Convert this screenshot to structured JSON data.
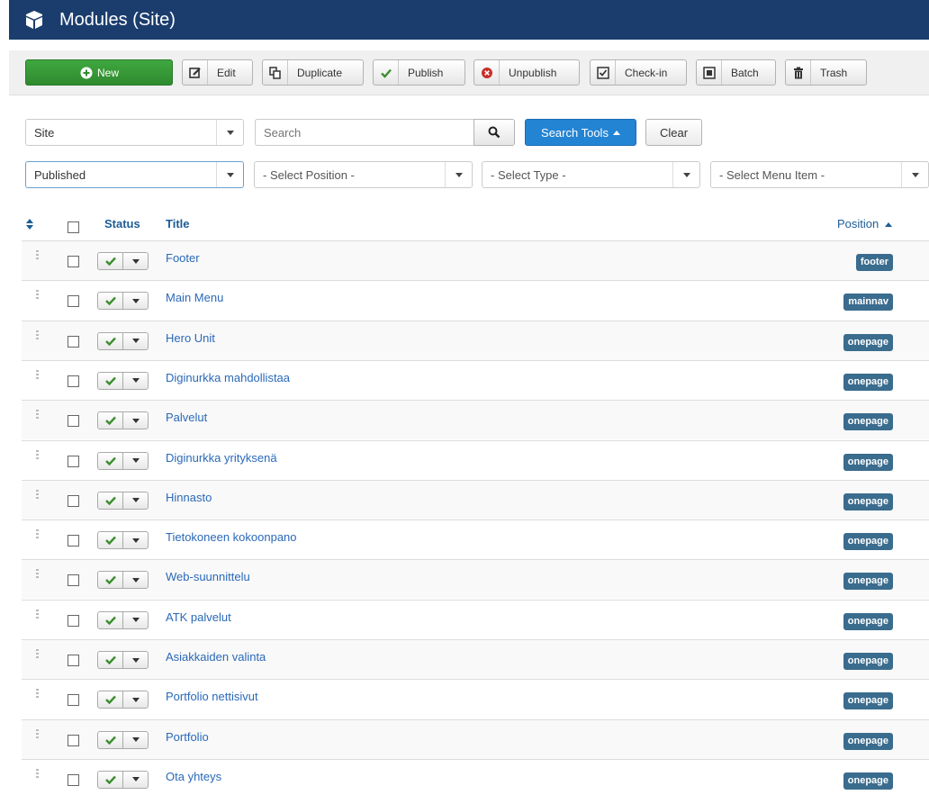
{
  "header": {
    "title": "Modules (Site)"
  },
  "toolbar": {
    "new": "New",
    "edit": "Edit",
    "duplicate": "Duplicate",
    "publish": "Publish",
    "unpublish": "Unpublish",
    "checkin": "Check-in",
    "batch": "Batch",
    "trash": "Trash"
  },
  "filters": {
    "client": "Site",
    "search_placeholder": "Search",
    "search_tools": "Search Tools",
    "clear": "Clear",
    "state": "Published",
    "position": "- Select Position -",
    "type": "- Select Type -",
    "menu_item": "- Select Menu Item -"
  },
  "table": {
    "headers": {
      "status": "Status",
      "title": "Title",
      "position": "Position"
    },
    "rows": [
      {
        "title": "Footer",
        "position": "footer"
      },
      {
        "title": "Main Menu",
        "position": "mainnav"
      },
      {
        "title": "Hero Unit",
        "position": "onepage"
      },
      {
        "title": "Diginurkka mahdollistaa",
        "position": "onepage"
      },
      {
        "title": "Palvelut",
        "position": "onepage"
      },
      {
        "title": "Diginurkka yrityksenä",
        "position": "onepage"
      },
      {
        "title": "Hinnasto",
        "position": "onepage"
      },
      {
        "title": "Tietokoneen kokoonpano",
        "position": "onepage"
      },
      {
        "title": "Web-suunnittelu",
        "position": "onepage"
      },
      {
        "title": "ATK palvelut",
        "position": "onepage"
      },
      {
        "title": "Asiakkaiden valinta",
        "position": "onepage"
      },
      {
        "title": "Portfolio nettisivut",
        "position": "onepage"
      },
      {
        "title": "Portfolio",
        "position": "onepage"
      },
      {
        "title": "Ota yhteys",
        "position": "onepage"
      }
    ]
  },
  "colors": {
    "header_bg": "#1b3d6e",
    "new_green": "#3fa83f",
    "link_blue": "#2a69b8",
    "badge": "#3a6c8e",
    "check_green": "#3c8d2f",
    "unpublish_red": "#c7302b"
  }
}
